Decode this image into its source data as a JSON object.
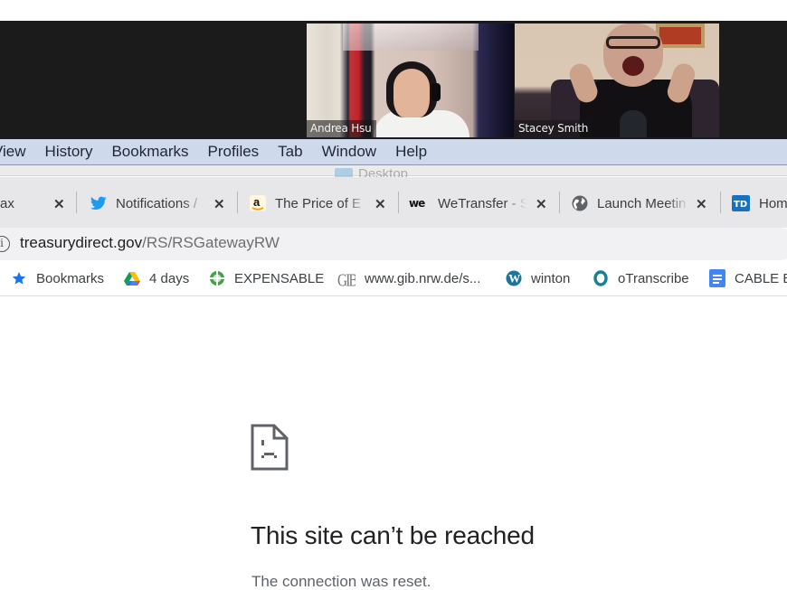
{
  "zoom_call": {
    "participants": [
      {
        "name": "Andrea Hsu"
      },
      {
        "name": "Stacey Smith"
      }
    ]
  },
  "menubar": {
    "items": [
      "View",
      "History",
      "Bookmarks",
      "Profiles",
      "Tab",
      "Window",
      "Help"
    ]
  },
  "desktop_overlay": {
    "label": "Desktop"
  },
  "tabs": [
    {
      "label": "ax",
      "icon": "none",
      "close": "✕"
    },
    {
      "label": "Notifications /",
      "icon": "twitter-icon",
      "close": "✕"
    },
    {
      "label": "The Price of E",
      "icon": "amazon-icon",
      "close": "✕"
    },
    {
      "label": "WeTransfer - S",
      "icon": "wetransfer-icon",
      "close": "✕"
    },
    {
      "label": "Launch Meetin",
      "icon": "globe-icon",
      "close": "✕"
    },
    {
      "label": "Hom",
      "icon": "treasurydirect-icon",
      "close": ""
    }
  ],
  "address_bar": {
    "host": "treasurydirect.gov",
    "path": "/RS/RSGatewayRW",
    "info_glyph": "i"
  },
  "bookmarks": [
    {
      "label": "Bookmarks",
      "icon": "star-icon"
    },
    {
      "label": "4 days",
      "icon": "google-drive-icon"
    },
    {
      "label": "EXPENSABLE",
      "icon": "expensable-icon"
    },
    {
      "label": "www.gib.nrw.de/s...",
      "icon": "gib-icon",
      "icon_text": "GIB"
    },
    {
      "label": "winton",
      "icon": "wordpress-icon"
    },
    {
      "label": "oTranscribe",
      "icon": "otranscribe-icon"
    },
    {
      "label": "CABLE E",
      "icon": "google-docs-icon"
    }
  ],
  "error_page": {
    "title": "This site can’t be reached",
    "detail": "The connection was reset."
  },
  "colors": {
    "menubar_bg": "#cfd9ec",
    "tabbar_bg": "#e7e7e9",
    "twitter_blue": "#1d9bf0",
    "treasury_blue": "#1672c0",
    "docs_blue": "#4285f4",
    "otranscribe_teal": "#16809a",
    "star_blue": "#1a73e8"
  }
}
